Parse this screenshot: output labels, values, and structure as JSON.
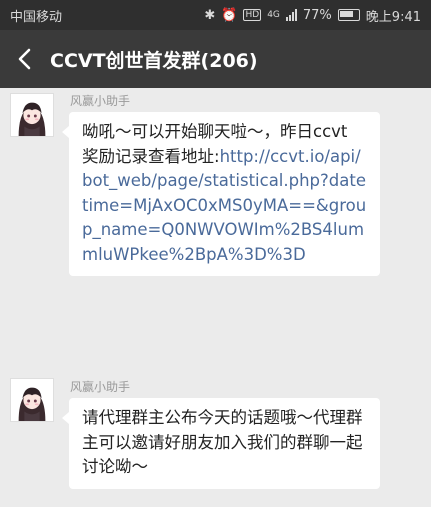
{
  "status_bar": {
    "carrier": "中国移动",
    "network_badge": "HD",
    "network_type": "4G",
    "battery": "77%",
    "time": "晚上9:41",
    "icons": [
      "bluetooth-icon",
      "alarm-icon",
      "hd-icon",
      "signal-icon",
      "battery-icon"
    ]
  },
  "nav": {
    "back_icon": "chevron-left-icon",
    "title": "CCVT创世首发群(206)"
  },
  "messages": [
    {
      "sender": "风赢小助手",
      "avatar": "anime-girl-avatar",
      "text": "呦吼～可以开始聊天啦～，昨日ccvt 奖励记录查看地址:",
      "link": "http://ccvt.io/api/bot_web/page/statistical.php?datetime=MjAxOC0xMS0yMA==&group_name=Q0NWVOWIm%2BS4lummluWPkee%2BpA%3D%3D"
    },
    {
      "sender": "风赢小助手",
      "avatar": "anime-girl-avatar",
      "text": "请代理群主公布今天的话题哦～代理群主可以邀请好朋友加入我们的群聊一起讨论呦～"
    }
  ]
}
